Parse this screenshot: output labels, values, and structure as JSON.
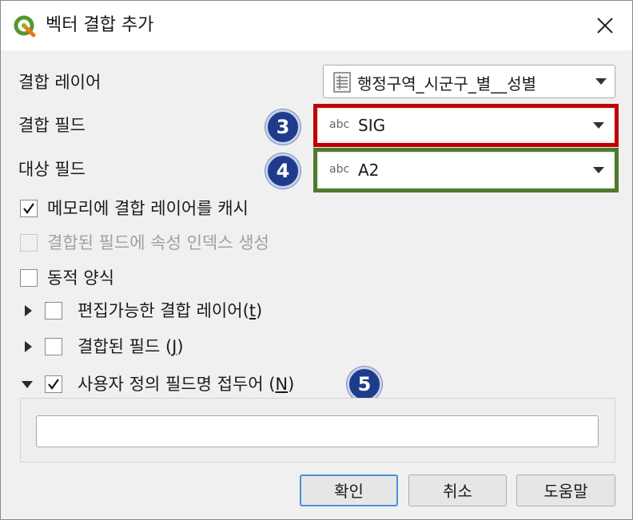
{
  "window": {
    "title": "벡터 결합 추가",
    "app_icon": "qgis-logo-icon",
    "close_icon": "close-icon"
  },
  "form": {
    "join_layer_label": "결합 레이어",
    "join_layer_value": "행정구역_시군구_별__성별",
    "join_layer_icon": "table-icon",
    "join_field_label": "결합 필드",
    "join_field_type": "abc",
    "join_field_value": "SIG",
    "target_field_label": "대상 필드",
    "target_field_type": "abc",
    "target_field_value": "A2"
  },
  "options": {
    "cache_label": "메모리에 결합 레이어를 캐시",
    "cache_checked": true,
    "index_label": "결합된 필드에 속성 인덱스 생성",
    "index_checked": false,
    "index_enabled": false,
    "dynamic_label": "동적 양식",
    "dynamic_checked": false
  },
  "groups": {
    "editable_label": "편집가능한 결합 레이어",
    "editable_shortcut": "t",
    "editable_checked": false,
    "editable_expanded": false,
    "joined_fields_label": "결합된 필드",
    "joined_fields_shortcut": "J",
    "joined_fields_checked": false,
    "joined_fields_expanded": false,
    "prefix_label": "사용자 정의 필드명 접두어",
    "prefix_shortcut": "N",
    "prefix_checked": true,
    "prefix_expanded": true,
    "prefix_value": ""
  },
  "annotations": {
    "badge_3": "3",
    "badge_4": "4",
    "badge_5": "5",
    "join_field_highlight_color": "#c00000",
    "target_field_highlight_color": "#4e7a2b",
    "badge_color": "#1f3c8c"
  },
  "buttons": {
    "ok": "확인",
    "cancel": "취소",
    "help": "도움말"
  },
  "colors": {
    "default_button_border": "#4a90d9"
  }
}
